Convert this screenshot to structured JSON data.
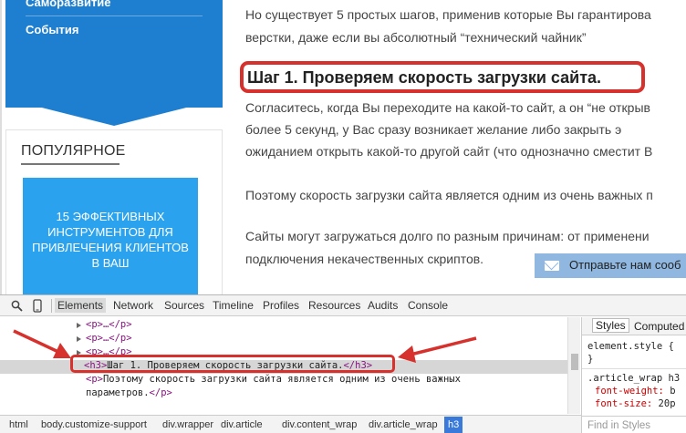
{
  "sidebar": {
    "menu_items": [
      "Саморазвитие",
      "События"
    ],
    "popular_title": "ПОПУЛЯРНОЕ",
    "popular_card_text": "15 ЭФФЕКТИВНЫХ ИНСТРУМЕНТОВ ДЛЯ ПРИВЛЕЧЕНИЯ КЛИЕНТОВ В ВАШ"
  },
  "article": {
    "intro_line1": "Но существует 5 простых шагов, применив которые Вы гарантирова",
    "intro_line2": "верстки, даже если вы абсолютный “технический чайник”",
    "heading": "Шаг 1. Проверяем скорость загрузки сайта.",
    "para1_line1": "Согласитесь, когда Вы переходите на какой-то сайт, а он “не открыв",
    "para1_line2": "более 5 секунд, у Вас сразу возникает желание либо закрыть э",
    "para1_line3": "ожиданием открыть какой-то другой сайт (что однозначно сместит В",
    "para2_line1": "Поэтому скорость загрузки сайта является одним из очень важных п",
    "para3_line1": "Сайты могут загружаться долго по разным причинам: от применени",
    "para3_line2": "подключения некачественных скриптов."
  },
  "feedback_tab": {
    "label": "Отправьте нам сооб"
  },
  "devtools": {
    "tabs": [
      "Elements",
      "Network",
      "Sources",
      "Timeline",
      "Profiles",
      "Resources",
      "Audits",
      "Console"
    ],
    "active_tab": "Elements",
    "dom_rows": {
      "p_collapsed": "<p>…</p>",
      "h3_open": "<h3>",
      "h3_text": "Шаг 1. Проверяем скорость загрузки сайта.",
      "h3_close": "</h3>",
      "p_open": "<p>",
      "p_text_line1": "Поэтому скорость загрузки сайта является одним из очень важных",
      "p_text_line2": "параметров.",
      "p_close": "</p>"
    },
    "styles_tabs": [
      "Styles",
      "Computed"
    ],
    "styles": {
      "element_style": "element.style {",
      "element_close": "}",
      "selector": ".article_wrap h3",
      "prop1_name": "font-weight:",
      "prop1_value": "b",
      "prop2_name": "font-size:",
      "prop2_value": "20p"
    },
    "find_in_styles": "Find in Styles",
    "breadcrumbs": [
      "html",
      "body.customize-support",
      "div.wrapper",
      "div.article",
      "div.content_wrap",
      "div.article_wrap",
      "h3"
    ],
    "active_breadcrumb": "h3"
  },
  "colors": {
    "sidebar_blue": "#1e7fd1",
    "card_blue": "#2aa2ee",
    "annotation_red": "#d6312c",
    "crumb_active": "#3879d9"
  }
}
